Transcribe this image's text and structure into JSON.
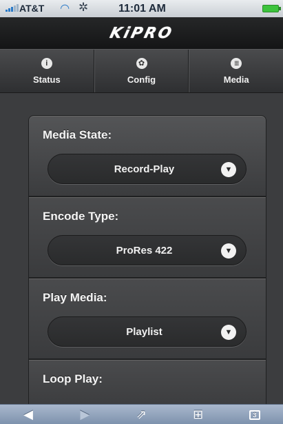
{
  "status_bar": {
    "carrier": "AT&T",
    "time": "11:01 AM",
    "signal_icon": "signal-bars-icon",
    "wifi_icon": "wifi-icon",
    "activity_icon": "activity-spinner-icon",
    "battery_icon": "battery-full-icon"
  },
  "app": {
    "logo_text": "KiPRO"
  },
  "tabs": [
    {
      "label": "Status",
      "icon": "info-icon",
      "glyph": "i"
    },
    {
      "label": "Config",
      "icon": "gear-icon",
      "glyph": "✿"
    },
    {
      "label": "Media",
      "icon": "grid-icon",
      "glyph": "⁞⁞⁞"
    }
  ],
  "settings": {
    "media_state": {
      "label": "Media State:",
      "value": "Record-Play"
    },
    "encode_type": {
      "label": "Encode Type:",
      "value": "ProRes 422"
    },
    "play_media": {
      "label": "Play Media:",
      "value": "Playlist"
    },
    "loop_play": {
      "label": "Loop Play:"
    }
  },
  "toolbar": {
    "back_icon": "back-arrow-icon",
    "forward_icon": "forward-arrow-icon",
    "share_icon": "share-icon",
    "bookmarks_icon": "bookmarks-icon",
    "tabs_icon": "tabs-icon",
    "tabs_count": "3"
  }
}
